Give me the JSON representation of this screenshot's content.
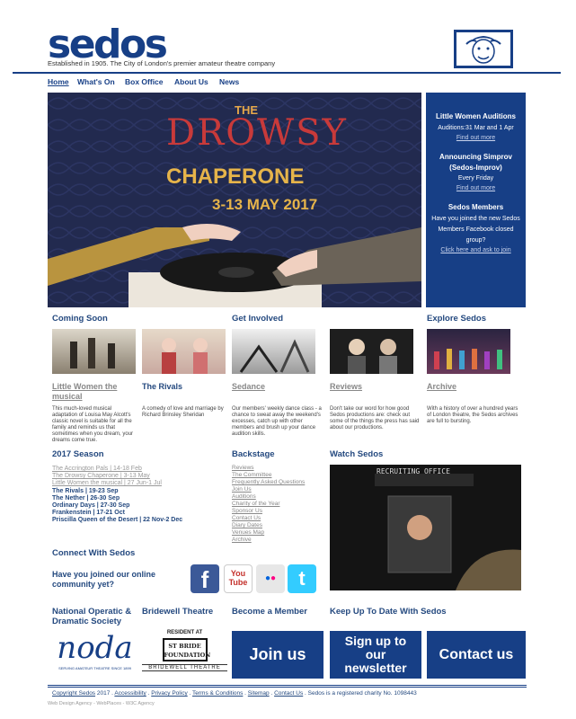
{
  "header": {
    "logo": "sedos",
    "tagline": "Established in 1905. The City of London's premier amateur theatre company"
  },
  "nav": [
    "Home",
    "What's On",
    "Box Office",
    "About Us",
    "News"
  ],
  "hero": {
    "the": "THE",
    "drowsy": "DROWSY",
    "chaperone": "CHAPERONE",
    "dates": "3-13 MAY 2017"
  },
  "sidebar": {
    "block1": {
      "title": "Little Women Auditions",
      "text": "Auditions:31 Mar and 1 Apr",
      "link": "Find out more"
    },
    "block2": {
      "title": "Announcing Simprov (Sedos-Improv)",
      "text": "Every Friday",
      "link": "Find out more"
    },
    "block3": {
      "title": "Sedos Members",
      "text": "Have you joined the new Sedos Members Facebook closed group?",
      "link": "Click here and ask to join"
    }
  },
  "sections": {
    "coming_soon": "Coming Soon",
    "get_involved": "Get Involved",
    "explore": "Explore Sedos"
  },
  "cards": [
    {
      "title": "Little Women the musical",
      "desc": "This much-loved musical adaptation of Louisa May Alcott's classic novel is suitable for all the family and reminds us that sometimes when you dream, your dreams come true."
    },
    {
      "title": "The Rivals",
      "desc": "A comedy of love and marriage by Richard Brinsley Sheridan"
    },
    {
      "title": "Sedance",
      "desc": "Our members' weekly dance class - a chance to sweat away the weekend's excesses, catch up with other members and brush up your dance audition skills."
    },
    {
      "title": "Reviews",
      "desc": "Don't take our word for how good Sedos productions are: check out some of the things the press has said about our productions."
    },
    {
      "title": "Archive",
      "desc": "With a history of over a hundred years of London theatre, the Sedos archives are full to bursting."
    }
  ],
  "season": {
    "title": "2017 Season",
    "past": [
      "The Accrington Pals | 14-18 Feb",
      "The Drowsy Chaperone | 3-13 May",
      "Little Women the musical | 27 Jun-1 Jul"
    ],
    "current": [
      "The Rivals | 19-23 Sep",
      "The Nether | 26-30 Sep",
      "Ordinary Days | 27-30 Sep",
      "Frankenstein | 17-21 Oct",
      "Priscilla Queen of the Desert | 22 Nov-2 Dec"
    ]
  },
  "backstage": {
    "title": "Backstage",
    "links": [
      "Reviews",
      "The Committee",
      "Frequently Asked Questions",
      "Join Us",
      "Auditions",
      "Charity of the Year",
      "Sponsor Us",
      "Contact Us",
      "Diary Dates",
      "Venues Map",
      "Archive"
    ]
  },
  "watch": {
    "title": "Watch Sedos",
    "sign": "RECRUITING OFFICE"
  },
  "connect": {
    "title": "Connect With Sedos",
    "question": "Have you joined our online community yet?",
    "social": [
      {
        "icon": "facebook-icon",
        "glyph": "f",
        "color": "#3b5998"
      },
      {
        "icon": "youtube-icon",
        "glyph": "You Tube",
        "color": "#c4302b"
      },
      {
        "icon": "flickr-icon",
        "glyph": "●●",
        "color": "#e7e7e7"
      },
      {
        "icon": "twitter-icon",
        "glyph": "t",
        "color": "#33ccff"
      }
    ]
  },
  "footer_blocks": {
    "noda_title": "National Operatic & Dramatic Society",
    "noda_logo": "noda",
    "noda_sub": "SERVING AMATEUR THEATRE SINCE 1899",
    "bridewell_title": "Bridewell Theatre",
    "bridewell_resident": "RESIDENT AT",
    "bridewell_logo": "ST BRIDE FOUNDATION",
    "bridewell_sub": "BRIDEWELL THEATRE",
    "member_title": "Become a Member",
    "join": "Join us",
    "newsletter_title": "Keep Up To Date With Sedos",
    "signup": "Sign up to our newsletter",
    "contact": "Contact us"
  },
  "footer": {
    "copyright": "Copyright Sedos",
    "year": "2017",
    "links": [
      "Accessibility",
      "Privacy Policy",
      "Terms & Conditions",
      "Sitemap",
      "Contact Us"
    ],
    "charity": "Sedos is a registered charity No. 1098443",
    "credit": "Web Design Agency - WebPlaces - W3C Agency"
  }
}
